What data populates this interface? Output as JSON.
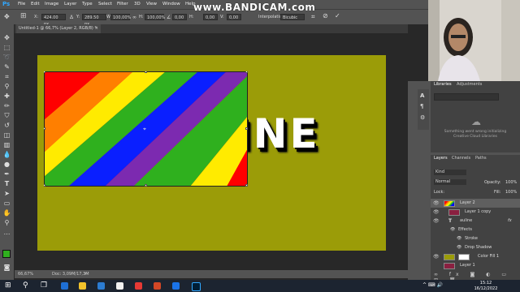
{
  "menu": {
    "app_icon": "Ps",
    "items": [
      "File",
      "Edit",
      "Image",
      "Layer",
      "Type",
      "Select",
      "Filter",
      "3D",
      "View",
      "Window",
      "Help"
    ]
  },
  "watermark": "www.BANDICAM.com",
  "options": {
    "x_label": "X:",
    "x_value": "424.00 px",
    "y_label": "Y:",
    "y_value": "289.50 px",
    "w_label": "W:",
    "w_value": "100,00%",
    "h_label": "H:",
    "h_value": "100,00%",
    "angle_value": "0,00",
    "hskew_label": "H:",
    "hskew_value": "0,00",
    "vskew_label": "V:",
    "vskew_value": "0,00",
    "interp_label": "Interpolation:",
    "interp_value": "Bicubic"
  },
  "document": {
    "tab_title": "Untitled-1 @ 66,7% (Layer 2, RGB/8) *",
    "text_content": "INE",
    "colors": {
      "background": "#9b9c08",
      "stripes": [
        "#ff0000",
        "#ff7f00",
        "#ffeb00",
        "#2fb01e",
        "#0a1fff",
        "#7c2ab0"
      ]
    }
  },
  "status": {
    "zoom": "66,67%",
    "doc_info": "Doc: 3,09M/17,3M"
  },
  "libraries": {
    "tabs": [
      "Libraries",
      "Adjustments"
    ],
    "message": "Something went wrong initializing Creative Cloud Libraries"
  },
  "layers": {
    "tabs": [
      "Layers",
      "Channels",
      "Paths"
    ],
    "kind_label": "Kind",
    "blend_mode": "Normal",
    "opacity_label": "Opacity:",
    "opacity_value": "100%",
    "lock_label": "Lock:",
    "fill_label": "Fill:",
    "fill_value": "100%",
    "items": [
      {
        "name": "Layer 2"
      },
      {
        "name": "Layer 1 copy"
      },
      {
        "name": "auline"
      },
      {
        "name": "Effects"
      },
      {
        "name": "Stroke"
      },
      {
        "name": "Drop Shadow"
      },
      {
        "name": "Color Fill 1"
      },
      {
        "name": "Layer 1"
      }
    ]
  },
  "taskbar": {
    "time": "15:12",
    "date": "16/12/2022"
  }
}
